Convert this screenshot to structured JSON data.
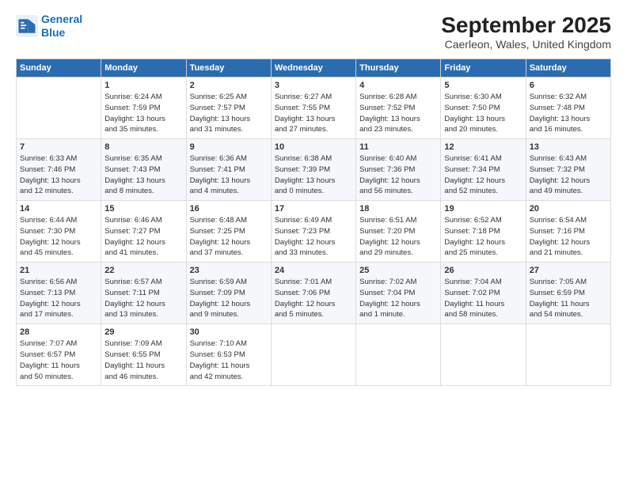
{
  "header": {
    "logo_line1": "General",
    "logo_line2": "Blue",
    "title": "September 2025",
    "subtitle": "Caerleon, Wales, United Kingdom"
  },
  "columns": [
    "Sunday",
    "Monday",
    "Tuesday",
    "Wednesday",
    "Thursday",
    "Friday",
    "Saturday"
  ],
  "weeks": [
    [
      {
        "num": "",
        "detail": ""
      },
      {
        "num": "1",
        "detail": "Sunrise: 6:24 AM\nSunset: 7:59 PM\nDaylight: 13 hours\nand 35 minutes."
      },
      {
        "num": "2",
        "detail": "Sunrise: 6:25 AM\nSunset: 7:57 PM\nDaylight: 13 hours\nand 31 minutes."
      },
      {
        "num": "3",
        "detail": "Sunrise: 6:27 AM\nSunset: 7:55 PM\nDaylight: 13 hours\nand 27 minutes."
      },
      {
        "num": "4",
        "detail": "Sunrise: 6:28 AM\nSunset: 7:52 PM\nDaylight: 13 hours\nand 23 minutes."
      },
      {
        "num": "5",
        "detail": "Sunrise: 6:30 AM\nSunset: 7:50 PM\nDaylight: 13 hours\nand 20 minutes."
      },
      {
        "num": "6",
        "detail": "Sunrise: 6:32 AM\nSunset: 7:48 PM\nDaylight: 13 hours\nand 16 minutes."
      }
    ],
    [
      {
        "num": "7",
        "detail": "Sunrise: 6:33 AM\nSunset: 7:46 PM\nDaylight: 13 hours\nand 12 minutes."
      },
      {
        "num": "8",
        "detail": "Sunrise: 6:35 AM\nSunset: 7:43 PM\nDaylight: 13 hours\nand 8 minutes."
      },
      {
        "num": "9",
        "detail": "Sunrise: 6:36 AM\nSunset: 7:41 PM\nDaylight: 13 hours\nand 4 minutes."
      },
      {
        "num": "10",
        "detail": "Sunrise: 6:38 AM\nSunset: 7:39 PM\nDaylight: 13 hours\nand 0 minutes."
      },
      {
        "num": "11",
        "detail": "Sunrise: 6:40 AM\nSunset: 7:36 PM\nDaylight: 12 hours\nand 56 minutes."
      },
      {
        "num": "12",
        "detail": "Sunrise: 6:41 AM\nSunset: 7:34 PM\nDaylight: 12 hours\nand 52 minutes."
      },
      {
        "num": "13",
        "detail": "Sunrise: 6:43 AM\nSunset: 7:32 PM\nDaylight: 12 hours\nand 49 minutes."
      }
    ],
    [
      {
        "num": "14",
        "detail": "Sunrise: 6:44 AM\nSunset: 7:30 PM\nDaylight: 12 hours\nand 45 minutes."
      },
      {
        "num": "15",
        "detail": "Sunrise: 6:46 AM\nSunset: 7:27 PM\nDaylight: 12 hours\nand 41 minutes."
      },
      {
        "num": "16",
        "detail": "Sunrise: 6:48 AM\nSunset: 7:25 PM\nDaylight: 12 hours\nand 37 minutes."
      },
      {
        "num": "17",
        "detail": "Sunrise: 6:49 AM\nSunset: 7:23 PM\nDaylight: 12 hours\nand 33 minutes."
      },
      {
        "num": "18",
        "detail": "Sunrise: 6:51 AM\nSunset: 7:20 PM\nDaylight: 12 hours\nand 29 minutes."
      },
      {
        "num": "19",
        "detail": "Sunrise: 6:52 AM\nSunset: 7:18 PM\nDaylight: 12 hours\nand 25 minutes."
      },
      {
        "num": "20",
        "detail": "Sunrise: 6:54 AM\nSunset: 7:16 PM\nDaylight: 12 hours\nand 21 minutes."
      }
    ],
    [
      {
        "num": "21",
        "detail": "Sunrise: 6:56 AM\nSunset: 7:13 PM\nDaylight: 12 hours\nand 17 minutes."
      },
      {
        "num": "22",
        "detail": "Sunrise: 6:57 AM\nSunset: 7:11 PM\nDaylight: 12 hours\nand 13 minutes."
      },
      {
        "num": "23",
        "detail": "Sunrise: 6:59 AM\nSunset: 7:09 PM\nDaylight: 12 hours\nand 9 minutes."
      },
      {
        "num": "24",
        "detail": "Sunrise: 7:01 AM\nSunset: 7:06 PM\nDaylight: 12 hours\nand 5 minutes."
      },
      {
        "num": "25",
        "detail": "Sunrise: 7:02 AM\nSunset: 7:04 PM\nDaylight: 12 hours\nand 1 minute."
      },
      {
        "num": "26",
        "detail": "Sunrise: 7:04 AM\nSunset: 7:02 PM\nDaylight: 11 hours\nand 58 minutes."
      },
      {
        "num": "27",
        "detail": "Sunrise: 7:05 AM\nSunset: 6:59 PM\nDaylight: 11 hours\nand 54 minutes."
      }
    ],
    [
      {
        "num": "28",
        "detail": "Sunrise: 7:07 AM\nSunset: 6:57 PM\nDaylight: 11 hours\nand 50 minutes."
      },
      {
        "num": "29",
        "detail": "Sunrise: 7:09 AM\nSunset: 6:55 PM\nDaylight: 11 hours\nand 46 minutes."
      },
      {
        "num": "30",
        "detail": "Sunrise: 7:10 AM\nSunset: 6:53 PM\nDaylight: 11 hours\nand 42 minutes."
      },
      {
        "num": "",
        "detail": ""
      },
      {
        "num": "",
        "detail": ""
      },
      {
        "num": "",
        "detail": ""
      },
      {
        "num": "",
        "detail": ""
      }
    ]
  ]
}
